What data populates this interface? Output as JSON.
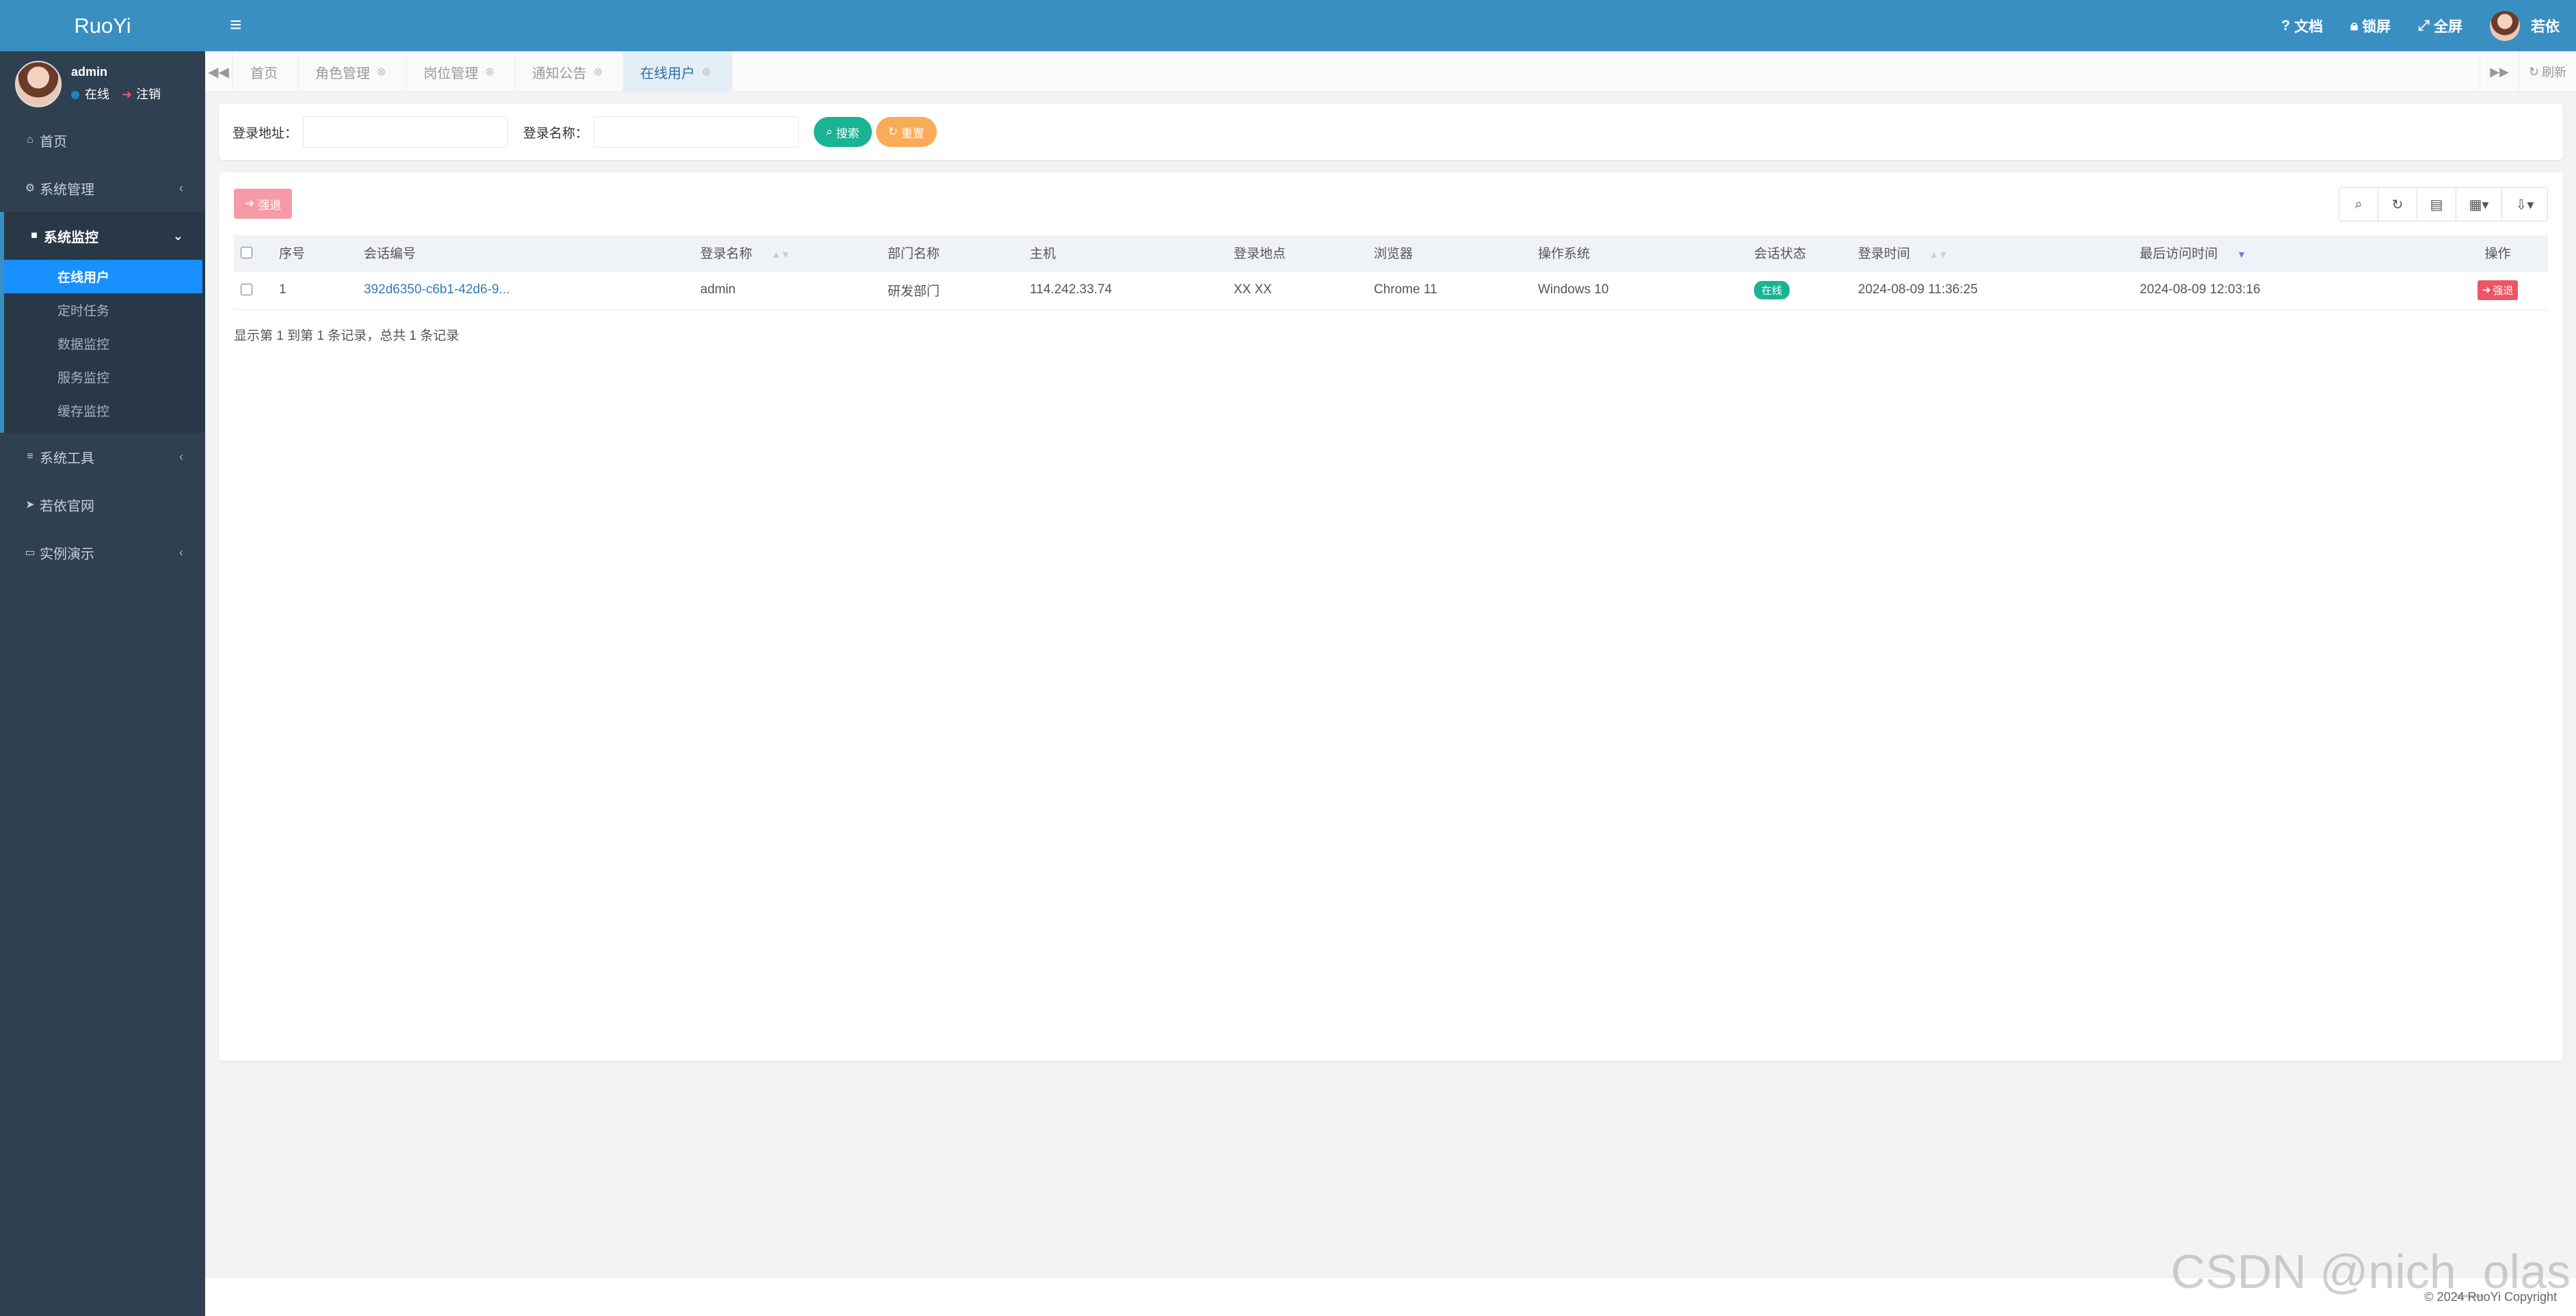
{
  "app": {
    "logo": "RuoYi"
  },
  "user": {
    "name": "admin",
    "status": "在线",
    "logout": "注销",
    "top_name": "若依"
  },
  "sidebar": {
    "items": [
      {
        "icon": "⌂",
        "label": "首页",
        "arrow": ""
      },
      {
        "icon": "⚙",
        "label": "系统管理",
        "arrow": "‹"
      },
      {
        "icon": "■",
        "label": "系统监控",
        "arrow": "⌄"
      },
      {
        "icon": "≡",
        "label": "系统工具",
        "arrow": "‹"
      },
      {
        "icon": "➤",
        "label": "若依官网",
        "arrow": ""
      },
      {
        "icon": "▭",
        "label": "实例演示",
        "arrow": "‹"
      }
    ],
    "monitor_sub": [
      "在线用户",
      "定时任务",
      "数据监控",
      "服务监控",
      "缓存监控"
    ]
  },
  "topbar": {
    "hamburger": "≡",
    "docs": "文档",
    "lock": "锁屏",
    "fullscreen": "全屏"
  },
  "tabs": {
    "items": [
      "首页",
      "角色管理",
      "岗位管理",
      "通知公告",
      "在线用户"
    ],
    "refresh": "刷新"
  },
  "search": {
    "ipaddr_label": "登录地址：",
    "ipaddr_value": "",
    "login_name_label": "登录名称：",
    "login_name_value": "",
    "search_btn": "搜索",
    "reset_btn": "重置"
  },
  "main": {
    "force_btn": "强退",
    "columns": [
      "序号",
      "会话编号",
      "登录名称",
      "部门名称",
      "主机",
      "登录地点",
      "浏览器",
      "操作系统",
      "会话状态",
      "登录时间",
      "最后访问时间",
      "操作"
    ],
    "rows": [
      {
        "index": "1",
        "session_id": "392d6350-c6b1-42d6-9...",
        "login_name": "admin",
        "dept": "研发部门",
        "host": "114.242.33.74",
        "location": "XX XX",
        "browser": "Chrome 11",
        "os": "Windows 10",
        "status": "在线",
        "login_time": "2024-08-09 11:36:25",
        "last_access": "2024-08-09 12:03:16",
        "action": "强退"
      }
    ],
    "pagination": "显示第 1 到第 1 条记录，总共 1 条记录"
  },
  "footer": {
    "copyright": "© 2024 RuoYi Copyright",
    "watermark": "CSDN @nich_olas"
  },
  "colors": {
    "primary": "#3a8fc2",
    "sidebar": "#2f4050",
    "active_sub": "#1890ff",
    "success": "#1ab394",
    "warning": "#f8ac59",
    "danger": "#ed5565"
  }
}
